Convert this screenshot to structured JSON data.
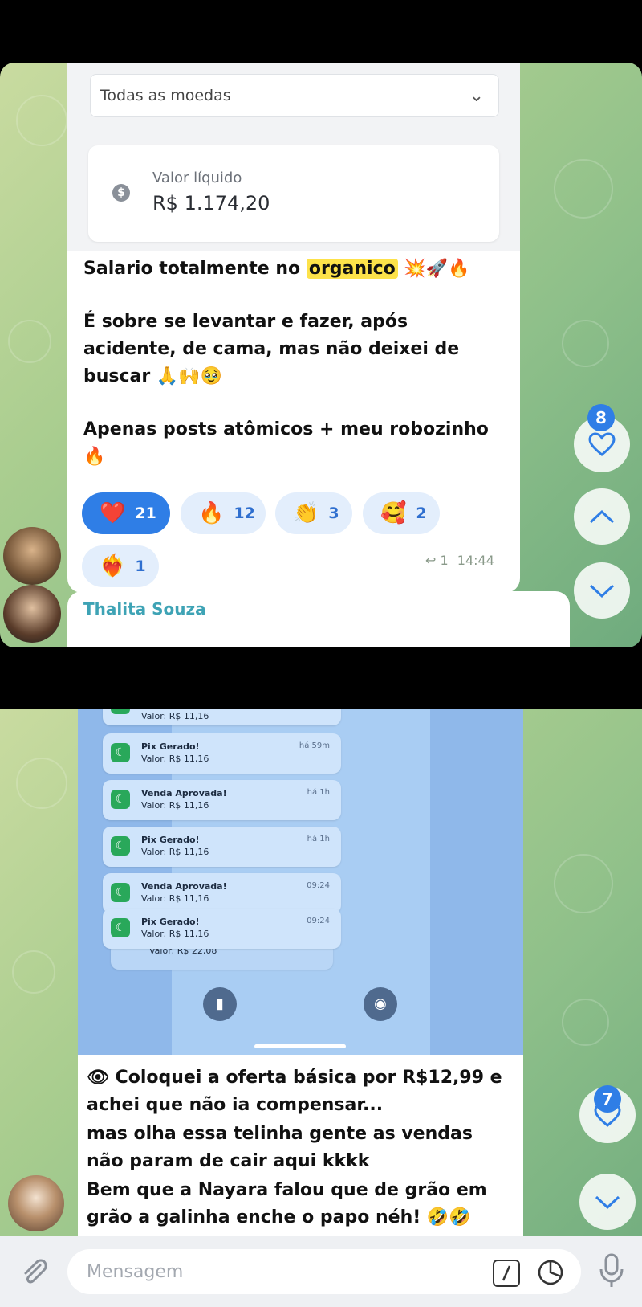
{
  "top_post": {
    "dropdown_value": "Todas as moedas",
    "valor_label": "Valor líquido",
    "valor_value": "R$ 1.174,20",
    "line1_pre": "Salario totalmente no ",
    "line1_highlight": "organico",
    "line1_emojis": " 💥🚀🔥",
    "para2_l1": "É sobre se levantar e fazer, após",
    "para2_l2": "acidente, de cama, mas não deixei de",
    "para2_l3": "buscar 🙏🙌🥹",
    "para3_l1": "Apenas posts atômicos + meu robozinho",
    "para3_l2": "🔥",
    "reactions": [
      {
        "emoji": "❤️",
        "count": "21"
      },
      {
        "emoji": "🔥",
        "count": "12"
      },
      {
        "emoji": "👏",
        "count": "3"
      },
      {
        "emoji": "🥰",
        "count": "2"
      },
      {
        "emoji": "❤️‍🔥",
        "count": "1"
      }
    ],
    "reply_count": "1",
    "time": "14:44",
    "next_sender": "Thalita Souza",
    "like_badge": "8"
  },
  "bottom_post": {
    "notifications": [
      {
        "title": "",
        "value": "Valor: R$ 11,16",
        "time": ""
      },
      {
        "title": "Pix Gerado!",
        "value": "Valor: R$ 11,16",
        "time": "há 59m"
      },
      {
        "title": "Venda Aprovada!",
        "value": "Valor: R$ 11,16",
        "time": "há 1h"
      },
      {
        "title": "Pix Gerado!",
        "value": "Valor: R$ 11,16",
        "time": "há 1h"
      },
      {
        "title": "Venda Aprovada!",
        "value": "Valor: R$ 11,16",
        "time": "09:24"
      },
      {
        "title": "Pix Gerado!",
        "value": "Valor: R$ 11,16",
        "time": "09:24"
      },
      {
        "title": "",
        "value": "Valor: R$ 22,08",
        "time": ""
      }
    ],
    "text_l1": "👁 Coloquei a oferta básica por R$12,99 e",
    "text_l2": "achei que não ia compensar...",
    "text_l3": "mas olha essa telinha gente as vendas",
    "text_l4": "não param de cair aqui kkkk",
    "text_l5": "Bem que a Nayara falou que de grão em",
    "text_l6": "grão a galinha enche o papo néh! 🤣🤣",
    "like_badge": "7",
    "input_placeholder": "Mensagem"
  },
  "icons": [
    "chevron-down-icon",
    "coin-icon",
    "reply-arrow-icon",
    "heart-icon",
    "chevron-up-icon",
    "flashlight-icon",
    "camera-icon",
    "paperclip-icon",
    "command-icon",
    "sticker-icon",
    "microphone-icon"
  ]
}
